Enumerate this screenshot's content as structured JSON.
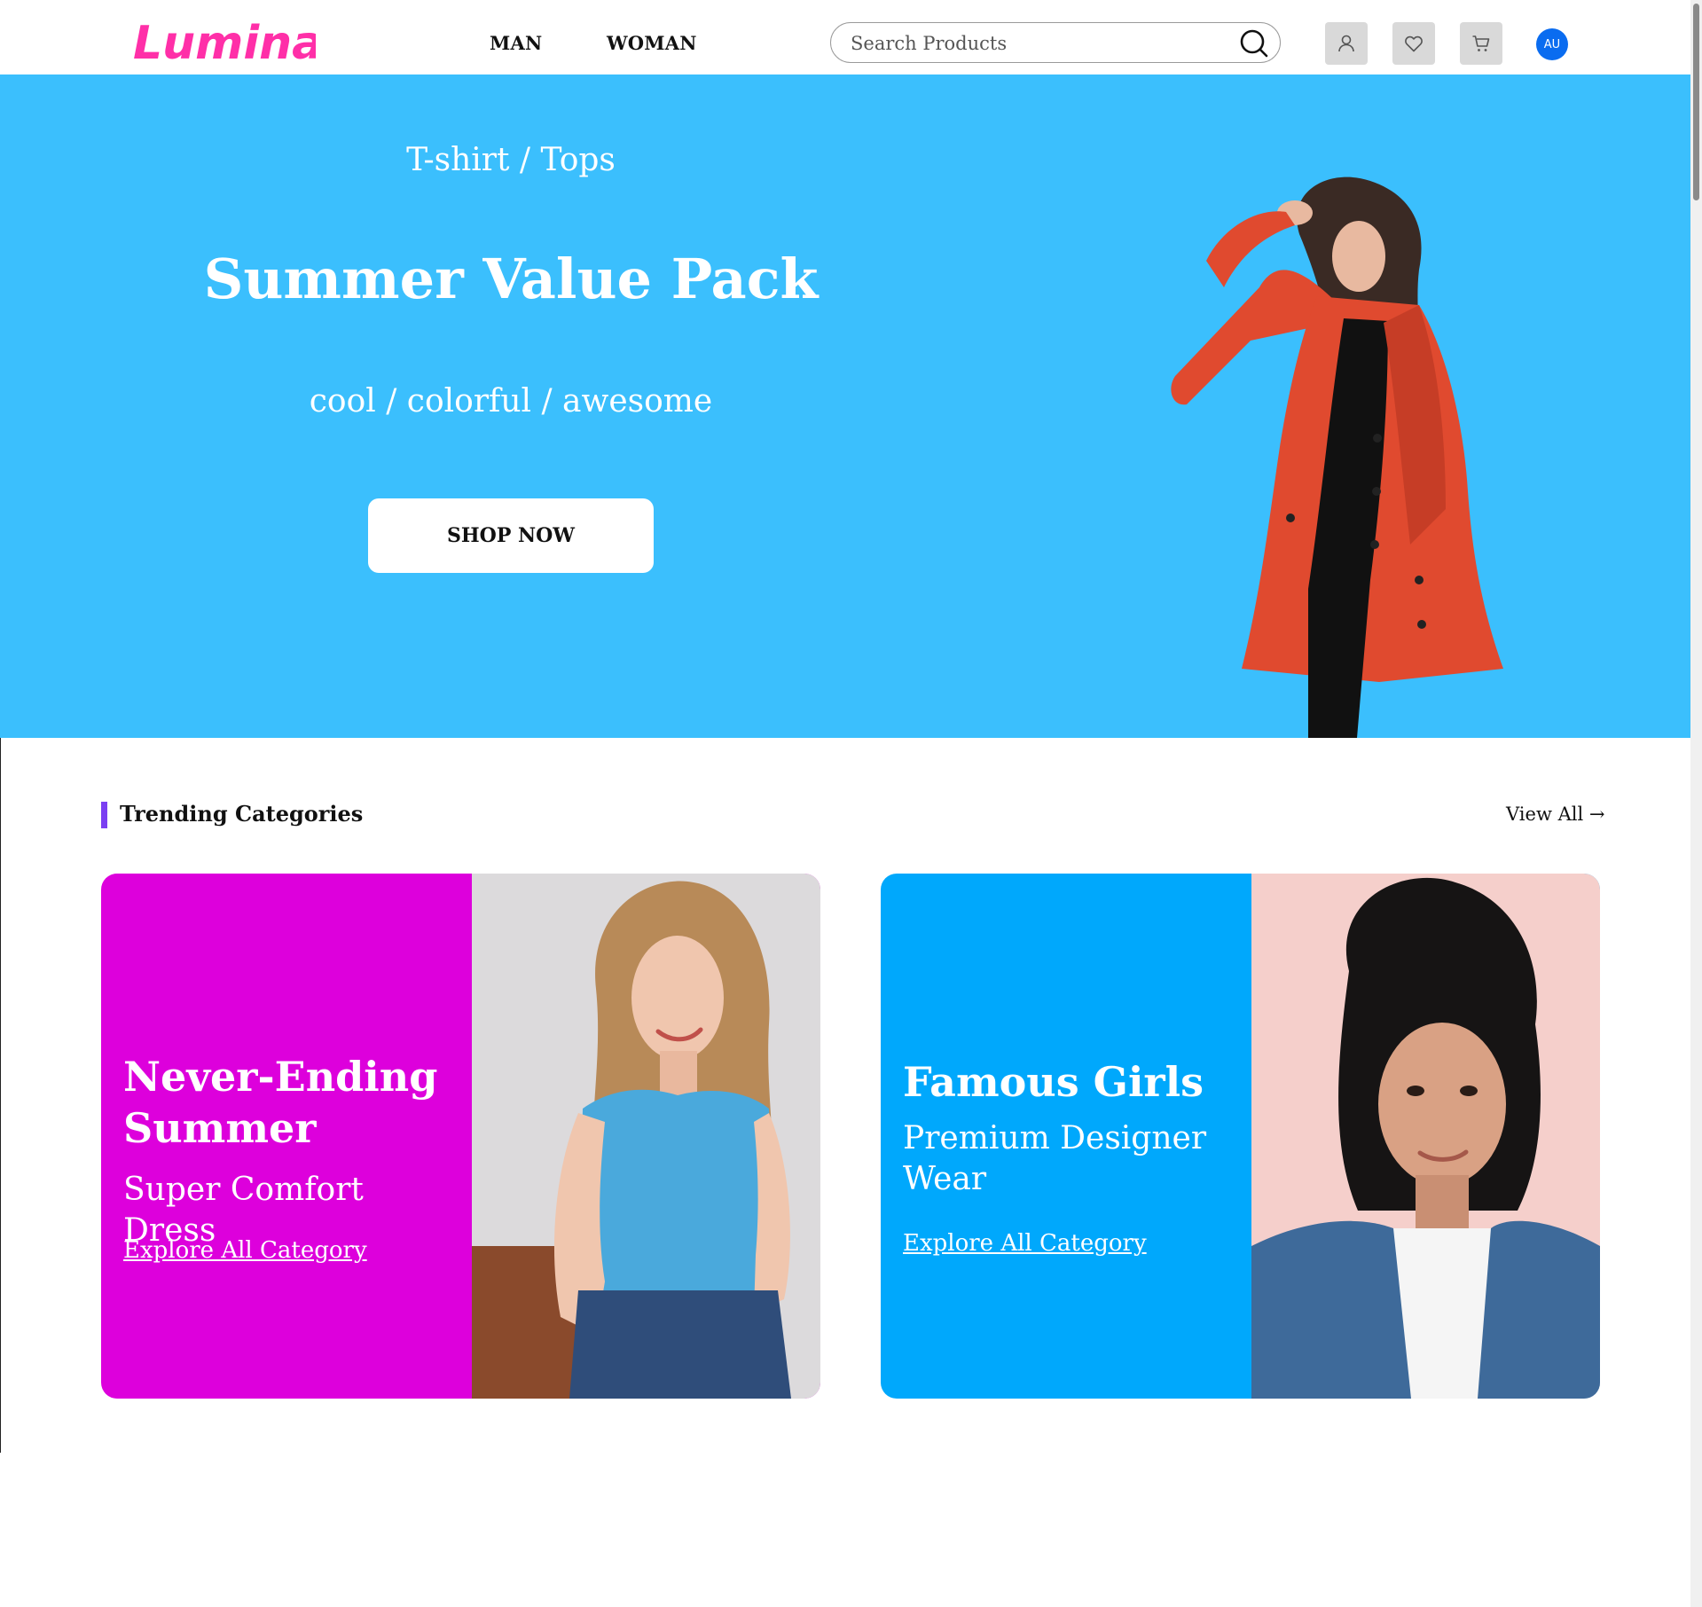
{
  "header": {
    "logo_text": "Luminae",
    "nav": [
      {
        "label": "MAN"
      },
      {
        "label": "WOMAN"
      }
    ],
    "search": {
      "placeholder": "Search Products",
      "value": ""
    },
    "icons": {
      "search": "search-icon",
      "account": "user-icon",
      "wishlist": "heart-icon",
      "cart": "cart-icon"
    },
    "avatar_initials": "AU"
  },
  "hero": {
    "subtitle": "T-shirt / Tops",
    "title": "Summer Value Pack",
    "tagline": "cool / colorful / awesome",
    "cta_label": "SHOP NOW",
    "background_color": "#3bbffd"
  },
  "trending": {
    "title": "Trending Categories",
    "view_all_label": "View All →",
    "accent_color": "#7b3ff2",
    "cards": [
      {
        "title": "Never-Ending Summer",
        "subtitle": "Super Comfort Dress",
        "link_label": "Explore All Category",
        "background_color": "#dd00dc"
      },
      {
        "title": "Famous Girls",
        "subtitle": "Premium Designer Wear",
        "link_label": "Explore All Category",
        "background_color": "#00a8fc"
      }
    ]
  }
}
